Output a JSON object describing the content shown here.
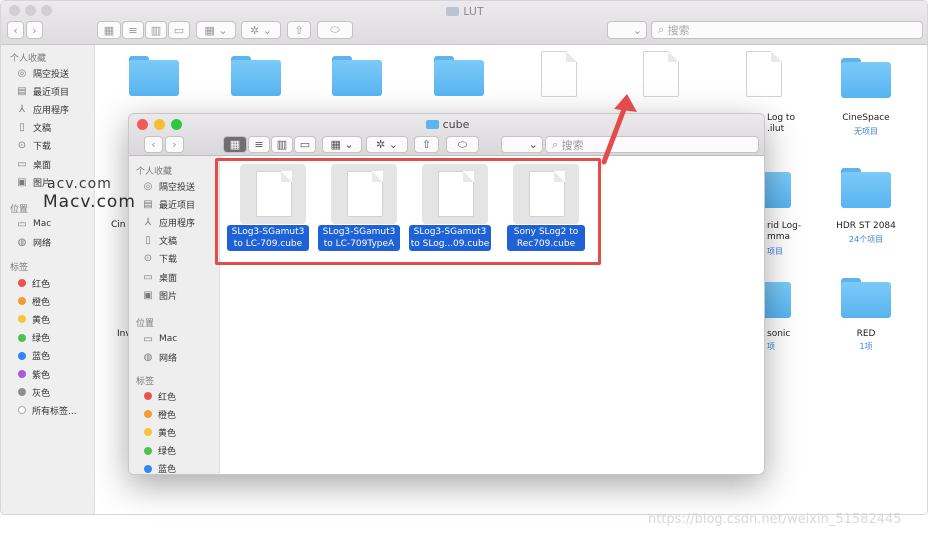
{
  "back_window": {
    "title": "LUT",
    "search_placeholder": "搜索",
    "sidebar": {
      "favorites_header": "个人收藏",
      "favorites": [
        {
          "label": "隔空投送",
          "icon": "airdrop-icon"
        },
        {
          "label": "最近项目",
          "icon": "recents-icon"
        },
        {
          "label": "应用程序",
          "icon": "applications-icon"
        },
        {
          "label": "文稿",
          "icon": "documents-icon"
        },
        {
          "label": "下载",
          "icon": "downloads-icon"
        },
        {
          "label": "桌面",
          "icon": "desktop-icon"
        },
        {
          "label": "图片",
          "icon": "pictures-icon"
        }
      ],
      "locations_header": "位置",
      "locations": [
        {
          "label": "Mac",
          "icon": "computer-icon"
        },
        {
          "label": "网络",
          "icon": "network-icon"
        }
      ],
      "tags_header": "标签",
      "tags": [
        {
          "label": "红色",
          "color": "#f0514b"
        },
        {
          "label": "橙色",
          "color": "#f59b2f"
        },
        {
          "label": "黄色",
          "color": "#f4c43a"
        },
        {
          "label": "绿色",
          "color": "#4cc24f"
        },
        {
          "label": "蓝色",
          "color": "#2f86f4"
        },
        {
          "label": "紫色",
          "color": "#a65cd6"
        },
        {
          "label": "灰色",
          "color": "#8e8e93"
        },
        {
          "label": "所有标签...",
          "color": "#ffffff"
        }
      ]
    },
    "items": [
      {
        "label": "Log to",
        "label2": ".ilut",
        "kind": "doc"
      },
      {
        "label": "CineSpace",
        "sub": "无项目",
        "kind": "folder"
      },
      {
        "label": "rid Log-",
        "label2": "mma",
        "sub": "项目",
        "kind": "folder"
      },
      {
        "label": "HDR ST 2084",
        "sub": "24个项目",
        "kind": "folder"
      },
      {
        "label": "sonic",
        "sub": "项",
        "kind": "folder"
      },
      {
        "label": "RED",
        "sub": "1项",
        "kind": "folder"
      },
      {
        "label": "Cin",
        "kind": "partial"
      },
      {
        "label": "Inv",
        "kind": "partial"
      }
    ]
  },
  "front_window": {
    "title": "cube",
    "search_placeholder": "搜索",
    "sidebar": {
      "favorites_header": "个人收藏",
      "favorites": [
        {
          "label": "隔空投送",
          "icon": "airdrop-icon"
        },
        {
          "label": "最近项目",
          "icon": "recents-icon"
        },
        {
          "label": "应用程序",
          "icon": "applications-icon"
        },
        {
          "label": "文稿",
          "icon": "documents-icon"
        },
        {
          "label": "下载",
          "icon": "downloads-icon"
        },
        {
          "label": "桌面",
          "icon": "desktop-icon"
        },
        {
          "label": "图片",
          "icon": "pictures-icon"
        }
      ],
      "locations_header": "位置",
      "locations": [
        {
          "label": "Mac",
          "icon": "computer-icon"
        },
        {
          "label": "网络",
          "icon": "network-icon"
        }
      ],
      "tags_header": "标签",
      "tags": [
        {
          "label": "红色",
          "color": "#f0514b"
        },
        {
          "label": "橙色",
          "color": "#f59b2f"
        },
        {
          "label": "黄色",
          "color": "#f4c43a"
        },
        {
          "label": "绿色",
          "color": "#4cc24f"
        },
        {
          "label": "蓝色",
          "color": "#2f86f4"
        }
      ]
    },
    "files": [
      {
        "line1": "SLog3-SGamut3",
        "line2": "to LC-709.cube"
      },
      {
        "line1": "SLog3-SGamut3",
        "line2": "to LC-709TypeA"
      },
      {
        "line1": "SLog3-SGamut3",
        "line2": "to SLog...09.cube"
      },
      {
        "line1": "Sony SLog2 to",
        "line2": "Rec709.cube"
      }
    ]
  },
  "overlay": {
    "watermark": "Macv.com",
    "watermark_small": "acv.com",
    "highlight_color": "#e54b4b",
    "credit": "https://blog.csdn.net/weixin_51582445"
  }
}
